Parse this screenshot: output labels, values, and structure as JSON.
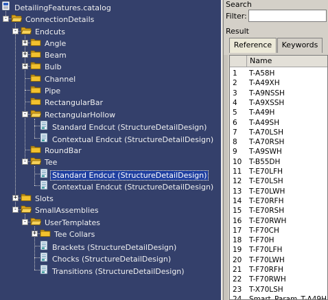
{
  "tree": {
    "nodes": [
      {
        "id": "root",
        "label": "DetailingFeatures.catalog",
        "icon": "catalog-icon",
        "exp": null
      },
      {
        "id": "cd",
        "label": "ConnectionDetails",
        "icon": "folder-open-icon",
        "exp": "-"
      },
      {
        "id": "endcuts",
        "label": "Endcuts",
        "icon": "folder-open-icon",
        "exp": "-"
      },
      {
        "id": "angle",
        "label": "Angle",
        "icon": "folder-icon",
        "exp": "+"
      },
      {
        "id": "beam",
        "label": "Beam",
        "icon": "folder-icon",
        "exp": "+"
      },
      {
        "id": "bulb",
        "label": "Bulb",
        "icon": "folder-icon",
        "exp": "+"
      },
      {
        "id": "channel",
        "label": "Channel",
        "icon": "folder-icon",
        "exp": null
      },
      {
        "id": "pipe",
        "label": "Pipe",
        "icon": "folder-icon",
        "exp": null
      },
      {
        "id": "rectbar",
        "label": "RectangularBar",
        "icon": "folder-icon",
        "exp": null
      },
      {
        "id": "recthollow",
        "label": "RectangularHollow",
        "icon": "folder-open-icon",
        "exp": "-"
      },
      {
        "id": "rh-std",
        "label": "Standard Endcut (StructureDetailDesign)",
        "icon": "document-icon",
        "exp": null
      },
      {
        "id": "rh-ctx",
        "label": "Contextual Endcut (StructureDetailDesign)",
        "icon": "document-icon",
        "exp": null
      },
      {
        "id": "roundbar",
        "label": "RoundBar",
        "icon": "folder-icon",
        "exp": null
      },
      {
        "id": "tee",
        "label": "Tee",
        "icon": "folder-open-icon",
        "exp": "-"
      },
      {
        "id": "tee-std",
        "label": "Standard Endcut (StructureDetailDesign)",
        "icon": "document-icon",
        "exp": null,
        "selected": true
      },
      {
        "id": "tee-ctx",
        "label": "Contextual Endcut (StructureDetailDesign)",
        "icon": "document-icon",
        "exp": null
      },
      {
        "id": "slots",
        "label": "Slots",
        "icon": "folder-icon",
        "exp": "+"
      },
      {
        "id": "sa",
        "label": "SmallAssemblies",
        "icon": "folder-open-icon",
        "exp": "-"
      },
      {
        "id": "ut",
        "label": "UserTemplates",
        "icon": "folder-open-icon",
        "exp": "-"
      },
      {
        "id": "tc",
        "label": "Tee Collars",
        "icon": "folder-icon",
        "exp": "+"
      },
      {
        "id": "brackets",
        "label": "Brackets (StructureDetailDesign)",
        "icon": "document-icon",
        "exp": null
      },
      {
        "id": "chocks",
        "label": "Chocks (StructureDetailDesign)",
        "icon": "document-icon",
        "exp": null
      },
      {
        "id": "transitions",
        "label": "Transitions (StructureDetailDesign)",
        "icon": "document-icon",
        "exp": null
      }
    ]
  },
  "panel": {
    "search_label": "Search",
    "filter_label": "Filter:",
    "filter_value": "",
    "result_label": "Result",
    "tabs": [
      {
        "label": "Reference",
        "active": true
      },
      {
        "label": "Keywords",
        "active": false
      }
    ],
    "column_header": "Name",
    "rows": [
      {
        "num": "1",
        "name": "T-A58H"
      },
      {
        "num": "2",
        "name": "T-A49XH"
      },
      {
        "num": "3",
        "name": "T-A9NSSH"
      },
      {
        "num": "4",
        "name": "T-A9XSSH"
      },
      {
        "num": "5",
        "name": "T-A49H"
      },
      {
        "num": "6",
        "name": "T-A49SH"
      },
      {
        "num": "7",
        "name": "T-A70LSH"
      },
      {
        "num": "8",
        "name": "T-A70RSH"
      },
      {
        "num": "9",
        "name": "T-A9SWH"
      },
      {
        "num": "10",
        "name": "T-B55DH"
      },
      {
        "num": "11",
        "name": "T-E70LFH"
      },
      {
        "num": "12",
        "name": "T-E70LSH"
      },
      {
        "num": "13",
        "name": "T-E70LWH"
      },
      {
        "num": "14",
        "name": "T-E70RFH"
      },
      {
        "num": "15",
        "name": "T-E70RSH"
      },
      {
        "num": "16",
        "name": "T-E70RWH"
      },
      {
        "num": "17",
        "name": "T-F70CH"
      },
      {
        "num": "18",
        "name": "T-F70H"
      },
      {
        "num": "19",
        "name": "T-F70LFH"
      },
      {
        "num": "20",
        "name": "T-F70LWH"
      },
      {
        "num": "21",
        "name": "T-F70RFH"
      },
      {
        "num": "22",
        "name": "T-F70RWH"
      },
      {
        "num": "23",
        "name": "T-X70LSH"
      },
      {
        "num": "24",
        "name": "Smart_Param_T-A49H"
      }
    ]
  },
  "colors": {
    "tree_bg": "#34406b",
    "selection": "#1f3fa0",
    "folder": "#f2c12e"
  }
}
